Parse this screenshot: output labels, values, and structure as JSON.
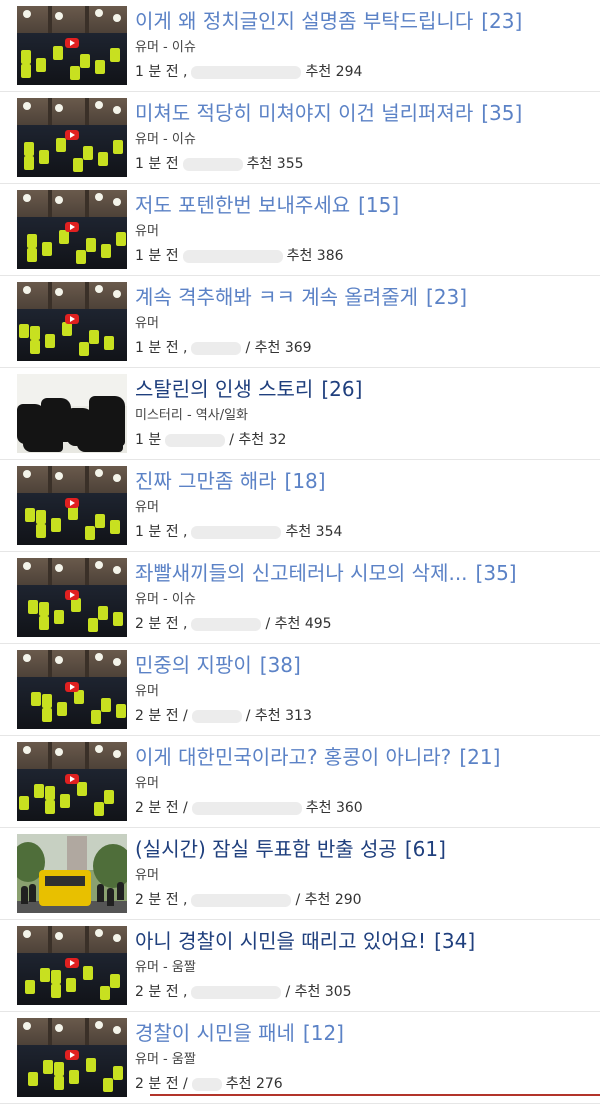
{
  "posts": [
    {
      "title": "이게 왜 정치글인지 설명좀 부탁드립니다",
      "comments": "[23]",
      "category": "유머 - 이슈",
      "time": "1 분 전 ,",
      "recommend": "추천 294",
      "thumb": "protest"
    },
    {
      "title": "미쳐도 적당히 미쳐야지 이건 널리퍼져라",
      "comments": "[35]",
      "category": "유머 - 이슈",
      "time": "1 분 전",
      "recommend": "추천 355",
      "thumb": "protest"
    },
    {
      "title": "저도 포텐한번 보내주세요",
      "comments": "[15]",
      "category": "유머",
      "time": "1 분 전",
      "recommend": "추천 386",
      "thumb": "protest"
    },
    {
      "title": "계속 격추해봐 ㅋㅋ 계속 올려줄게",
      "comments": "[23]",
      "category": "유머",
      "time": "1 분 전 ,",
      "recommend": "/ 추천 369",
      "thumb": "protest"
    },
    {
      "title": "스탈린의 인생 스토리",
      "comments": "[26]",
      "category": "미스터리 - 역사/일화",
      "time": "1 분",
      "recommend": "/ 추천 32",
      "thumb": "herd",
      "visited": false
    },
    {
      "title": "진짜 그만좀 해라",
      "comments": "[18]",
      "category": "유머",
      "time": "1 분 전 ,",
      "recommend": "추천 354",
      "thumb": "protest"
    },
    {
      "title": "좌빨새끼들의 신고테러나 시모의 삭제...",
      "comments": "[35]",
      "category": "유머 - 이슈",
      "time": "2 분 전 ,",
      "recommend": "/ 추천 495",
      "thumb": "protest"
    },
    {
      "title": "민중의 지팡이",
      "comments": "[38]",
      "category": "유머",
      "time": "2 분 전 /",
      "recommend": "/ 추천 313",
      "thumb": "protest"
    },
    {
      "title": "이게 대한민국이라고? 홍콩이 아니라?",
      "comments": "[21]",
      "category": "유머",
      "time": "2 분 전 /",
      "recommend": "추천 360",
      "thumb": "protest"
    },
    {
      "title": "(실시간) 잠실 투표함 반출 성공",
      "comments": "[61]",
      "category": "유머",
      "time": "2 분 전 ,",
      "recommend": "/ 추천 290",
      "thumb": "bus",
      "visited": false
    },
    {
      "title": "아니 경찰이 시민을 때리고 있어요!",
      "comments": "[34]",
      "category": "유머 - 움짤",
      "time": "2 분 전 ,",
      "recommend": "/ 추천 305",
      "thumb": "protest",
      "visited": false
    },
    {
      "title": "경찰이 시민을 패네",
      "comments": "[12]",
      "category": "유머 - 움짤",
      "time": "2 분 전 /",
      "recommend": "추천 276",
      "thumb": "protest"
    }
  ],
  "colors": {
    "visited_link": "#5b82c6",
    "unvisited_link": "#1f3f7d",
    "meta_text": "#333333"
  }
}
